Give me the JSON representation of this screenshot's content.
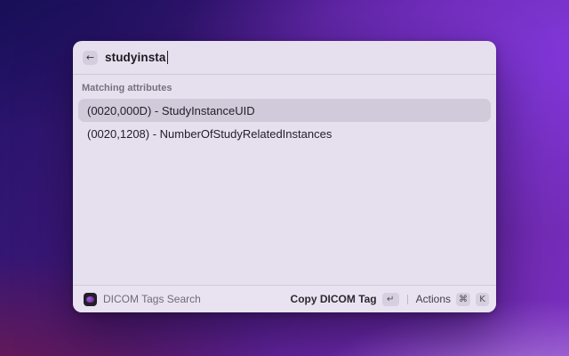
{
  "window": {
    "search": {
      "value": "studyinsta",
      "back_icon": "←"
    },
    "section_header": "Matching attributes",
    "results": [
      {
        "label": "(0020,000D) - StudyInstanceUID",
        "selected": true
      },
      {
        "label": "(0020,1208) - NumberOfStudyRelatedInstances",
        "selected": false
      }
    ],
    "footer": {
      "app_name": "DICOM Tags Search",
      "primary_action": "Copy DICOM Tag",
      "primary_key": "↵",
      "actions_label": "Actions",
      "cmd_key": "⌘",
      "k_key": "K"
    }
  },
  "colors": {
    "window_bg": "#e6e0ee",
    "selected_row_bg": "#d1cadb",
    "footer_bg": "#e9e3f1",
    "gradient_top_left": "#140d50",
    "gradient_top_right": "#8238dc",
    "gradient_bottom_left": "#701a4e",
    "gradient_bottom_right": "#b78ade"
  }
}
